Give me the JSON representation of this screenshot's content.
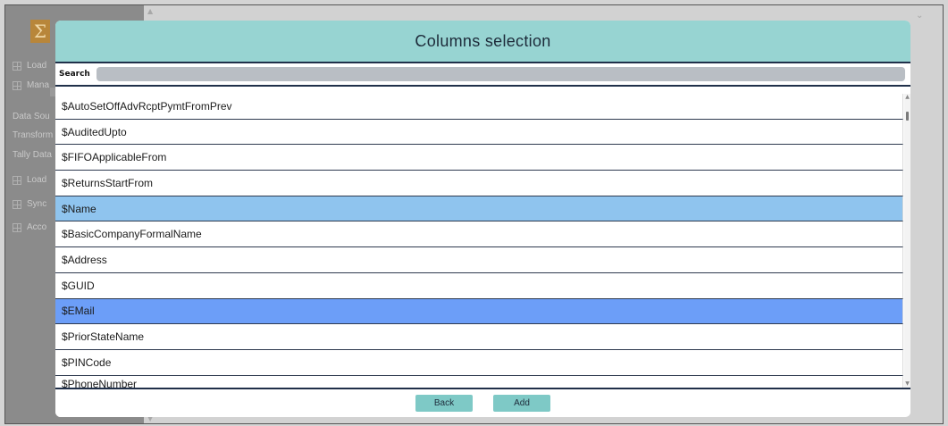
{
  "background_app": {
    "sidebar_items": [
      "Load",
      "Mana",
      "Data Sou",
      "Transform",
      "Tally Data",
      "Load",
      "Sync",
      "Acco"
    ]
  },
  "modal": {
    "title": "Columns selection",
    "search": {
      "label": "Search",
      "value": "",
      "placeholder": ""
    },
    "columns": [
      {
        "label": "$AutoSetOffAdvRcptPymtFromPrev",
        "state": "normal"
      },
      {
        "label": "$AuditedUpto",
        "state": "normal"
      },
      {
        "label": "$FIFOApplicableFrom",
        "state": "normal"
      },
      {
        "label": "$ReturnsStartFrom",
        "state": "normal"
      },
      {
        "label": "$Name",
        "state": "highlighted"
      },
      {
        "label": "$BasicCompanyFormalName",
        "state": "normal"
      },
      {
        "label": "$Address",
        "state": "normal"
      },
      {
        "label": "$GUID",
        "state": "normal"
      },
      {
        "label": "$EMail",
        "state": "selected"
      },
      {
        "label": "$PriorStateName",
        "state": "normal"
      },
      {
        "label": "$PINCode",
        "state": "normal"
      },
      {
        "label": "$PhoneNumber",
        "state": "partially-visible"
      }
    ],
    "buttons": {
      "back": "Back",
      "add": "Add"
    }
  },
  "colors": {
    "header_bg": "#97d4d2",
    "highlight_row": "#8fc4ee",
    "selected_row": "#6c9ef8",
    "button_bg": "#7ec9c6"
  }
}
